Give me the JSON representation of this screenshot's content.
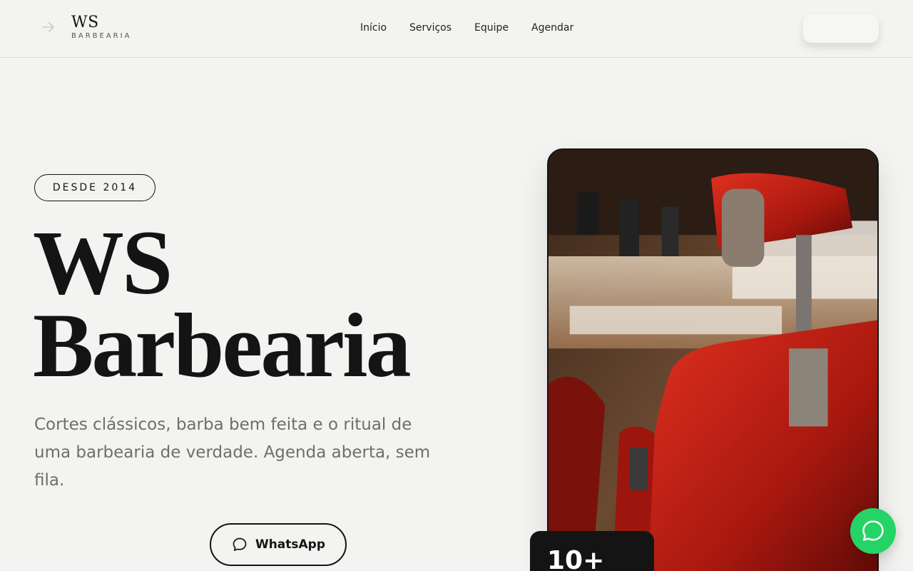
{
  "brand": {
    "name": "WS",
    "tagline": "BARBEARIA"
  },
  "nav": {
    "items": [
      "Início",
      "Serviços",
      "Equipe",
      "Agendar"
    ]
  },
  "header_button": {
    "label": ""
  },
  "hero": {
    "badge": "DESDE 2014",
    "title_line1": "WS",
    "title_line2": "Barbearia",
    "description": "Cortes clássicos, barba bem feita e o ritual de uma barbearia de verdade. Agenda aberta, sem fila.",
    "whatsapp_label": "WhatsApp",
    "stat_value": "10+"
  },
  "icons": {
    "brand": "arrow-right-icon",
    "whatsapp_button": "chat-bubble-icon",
    "floating": "whatsapp-icon"
  },
  "colors": {
    "background": "#f3f3f1",
    "text": "#141414",
    "muted": "#6e6e6a",
    "whatsapp_green": "#25d366",
    "chair_red": "#c8231a"
  }
}
